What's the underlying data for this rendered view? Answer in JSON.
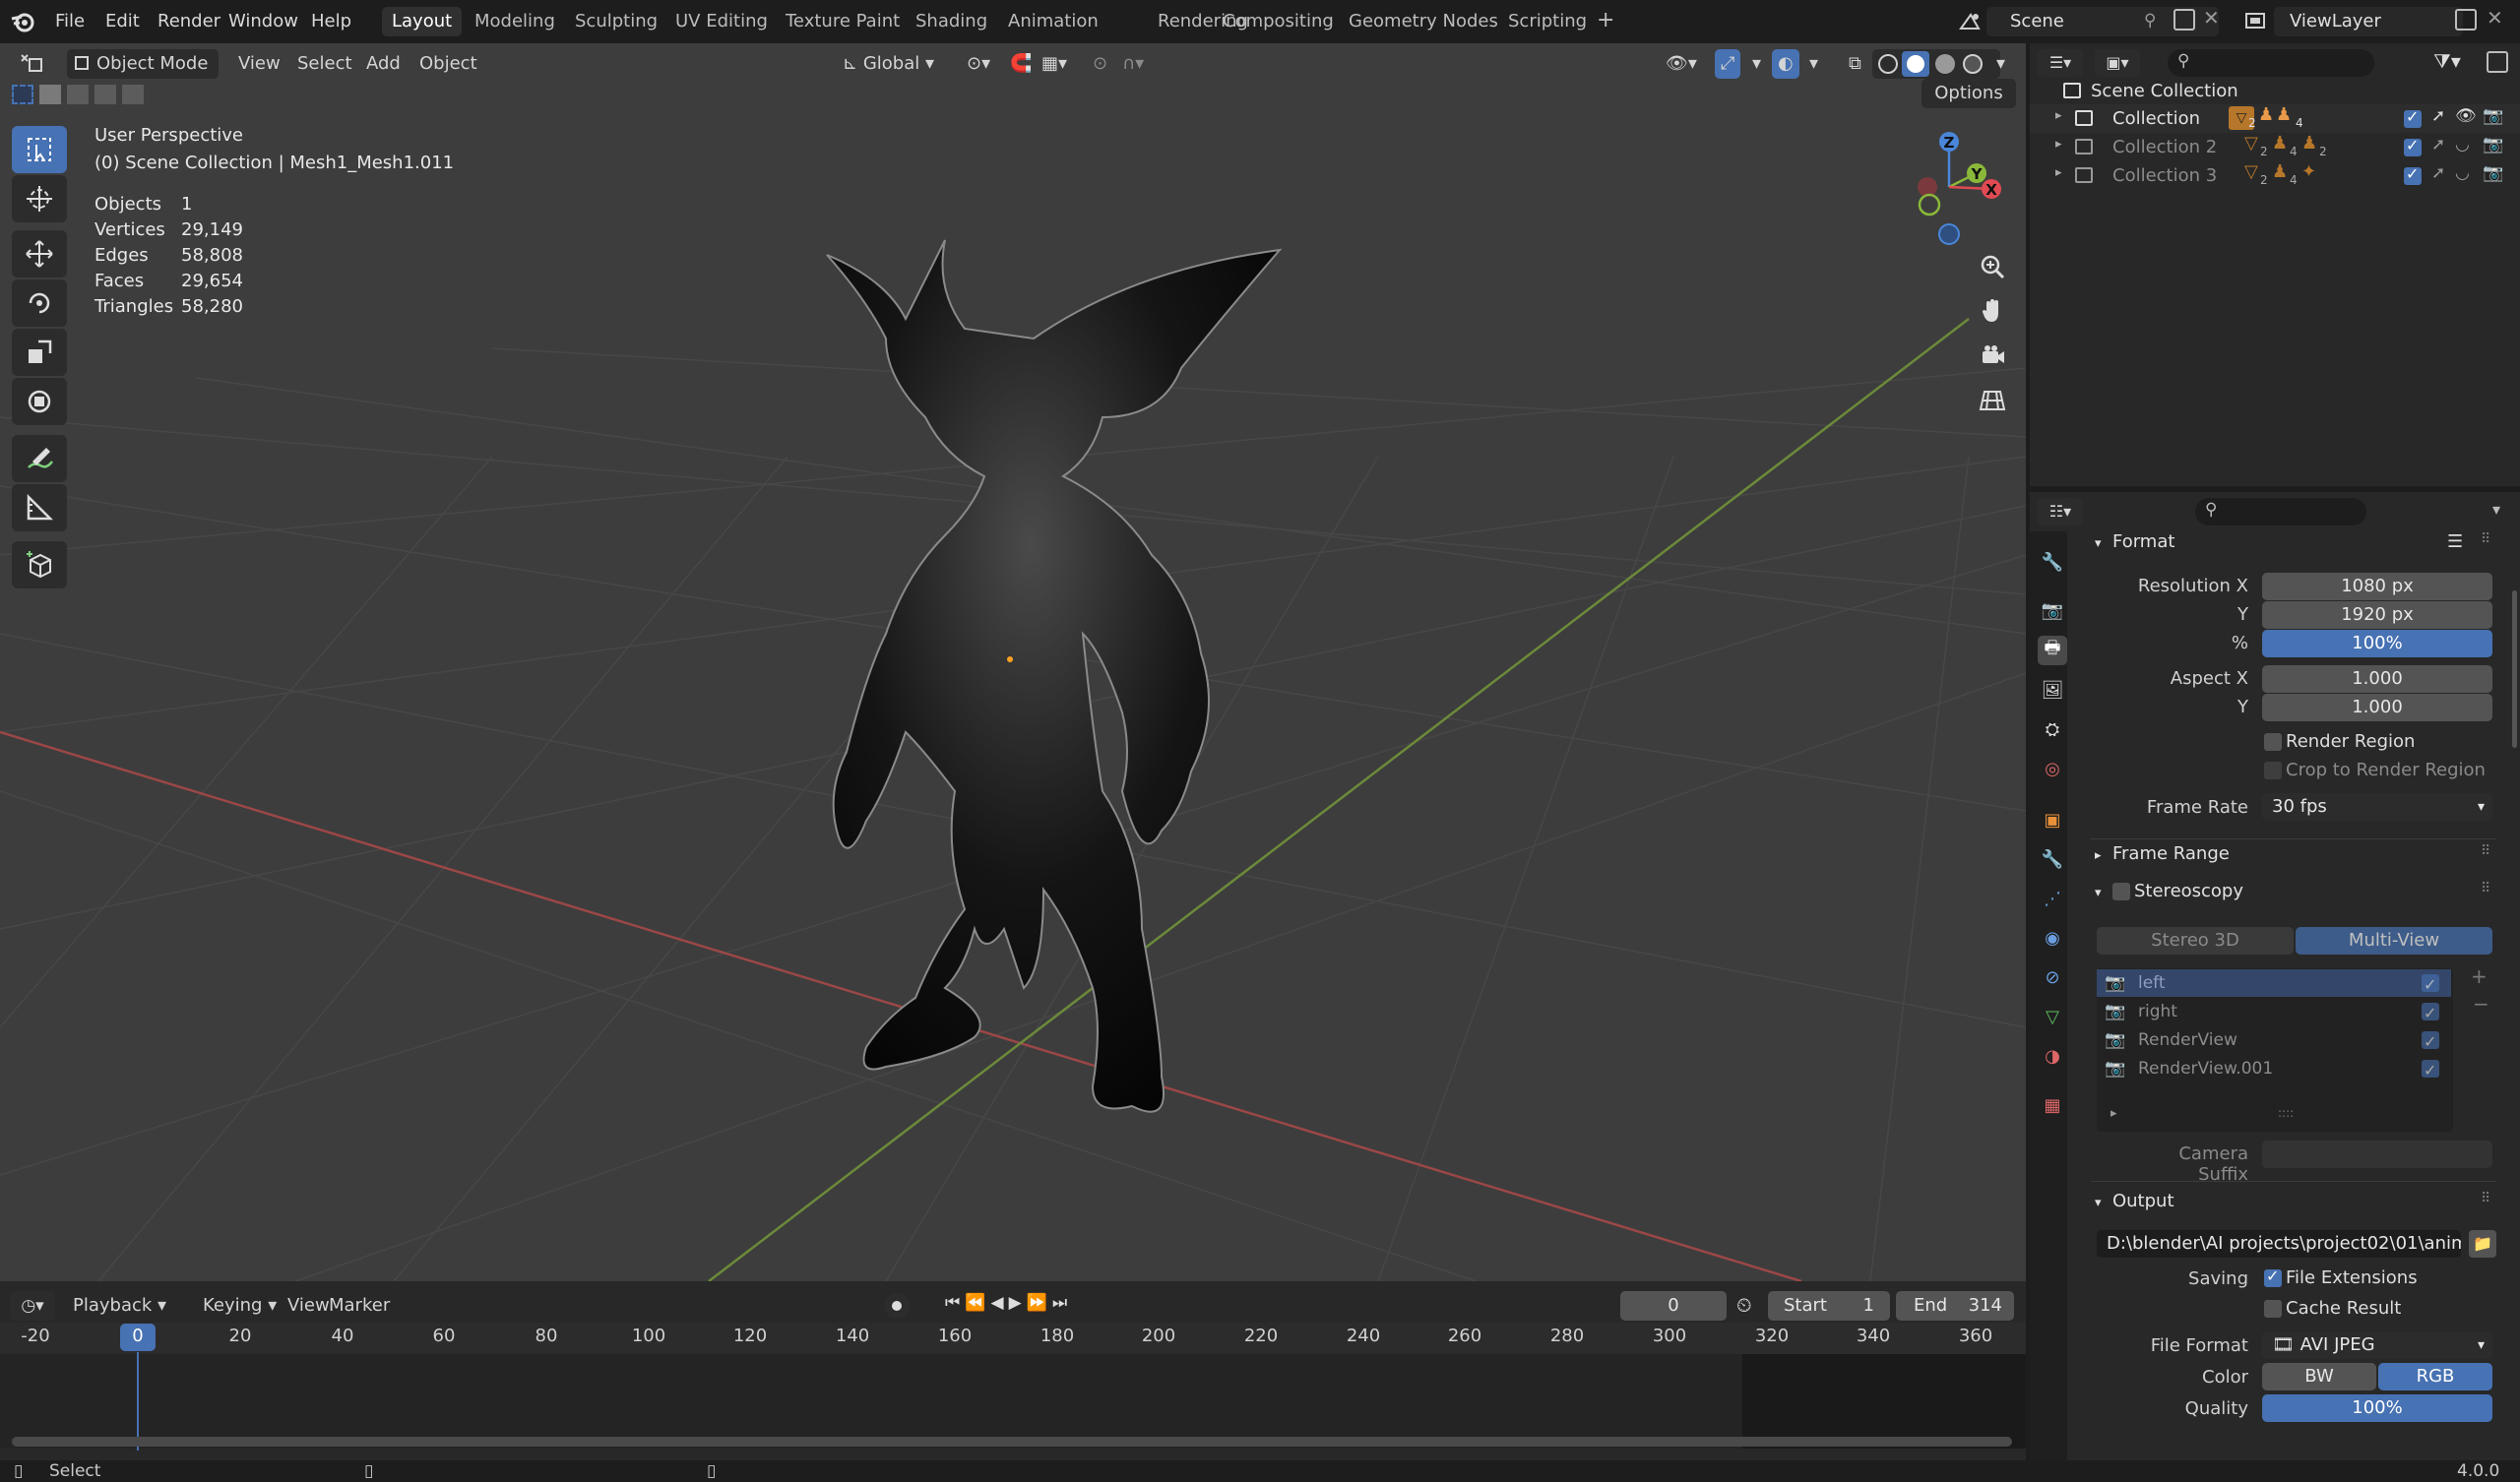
{
  "topbar": {
    "menus": [
      "File",
      "Edit",
      "Render",
      "Window",
      "Help"
    ],
    "workspaces": [
      "Layout",
      "Modeling",
      "Sculpting",
      "UV Editing",
      "Texture Paint",
      "Shading",
      "Animation",
      "Rendering",
      "Compositing",
      "Geometry Nodes",
      "Scripting"
    ],
    "active_workspace": "Layout",
    "scene": "Scene",
    "view_layer": "ViewLayer"
  },
  "viewport_header": {
    "mode": "Object Mode",
    "menus": [
      "View",
      "Select",
      "Add",
      "Object"
    ],
    "orientation": "Global",
    "options": "Options"
  },
  "overlay": {
    "perspective": "User Perspective",
    "context": "(0) Scene Collection | Mesh1_Mesh1.011",
    "stats": [
      {
        "label": "Objects",
        "value": "1"
      },
      {
        "label": "Vertices",
        "value": "29,149"
      },
      {
        "label": "Edges",
        "value": "58,808"
      },
      {
        "label": "Faces",
        "value": "29,654"
      },
      {
        "label": "Triangles",
        "value": "58,280"
      }
    ]
  },
  "gizmo": {
    "z": "Z",
    "y": "Y",
    "x": "X"
  },
  "timeline": {
    "menus": [
      "Playback",
      "Keying",
      "View",
      "Marker"
    ],
    "current_frame": "0",
    "start_label": "Start",
    "start": "1",
    "end_label": "End",
    "end": "314",
    "ticks": [
      "-20",
      "0",
      "20",
      "40",
      "60",
      "80",
      "100",
      "120",
      "140",
      "160",
      "180",
      "200",
      "220",
      "240",
      "260",
      "280",
      "300",
      "320",
      "340",
      "360"
    ]
  },
  "statusbar": {
    "left": "Select",
    "version": "4.0.0"
  },
  "outliner": {
    "root": "Scene Collection",
    "collections": [
      {
        "name": "Collection",
        "counts": [
          "2",
          "4"
        ]
      },
      {
        "name": "Collection 2",
        "counts": [
          "2",
          "4",
          "2"
        ]
      },
      {
        "name": "Collection 3",
        "counts": [
          "2",
          "4"
        ]
      }
    ]
  },
  "properties": {
    "format": {
      "title": "Format",
      "resolution_x_label": "Resolution X",
      "resolution_x": "1080 px",
      "y_label": "Y",
      "resolution_y": "1920 px",
      "pct_label": "%",
      "pct": "100%",
      "aspect_x_label": "Aspect X",
      "aspect_x": "1.000",
      "aspect_y_label": "Y",
      "aspect_y": "1.000",
      "render_region": "Render Region",
      "crop_region": "Crop to Render Region",
      "frame_rate_label": "Frame Rate",
      "frame_rate": "30 fps"
    },
    "frame_range": {
      "title": "Frame Range"
    },
    "stereoscopy": {
      "title": "Stereoscopy",
      "tab_stereo": "Stereo 3D",
      "tab_multi": "Multi-View",
      "views": [
        "left",
        "right",
        "RenderView",
        "RenderView.001"
      ],
      "camera_suffix": "Camera Suffix"
    },
    "output": {
      "title": "Output",
      "path": "D:\\blender\\AI projects\\project02\\01\\anima...",
      "saving_label": "Saving",
      "file_extensions": "File Extensions",
      "cache_result": "Cache Result",
      "file_format_label": "File Format",
      "file_format": "AVI JPEG",
      "color_label": "Color",
      "color_bw": "BW",
      "color_rgb": "RGB",
      "quality_label": "Quality",
      "quality": "100%"
    }
  }
}
